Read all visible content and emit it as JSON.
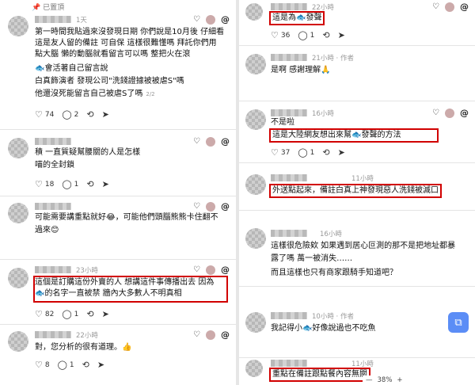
{
  "left": {
    "top_label": "已置頂",
    "posts": [
      {
        "time": "1天",
        "lines": [
          "第一時間我貼過來沒發現日期 你們說是10月後 仔細看",
          "這是友人留的備註 可自保 這樣很難懂嗎 拜託你們用",
          "點大腦 懶的動腦就看留言可以嗎 整把火在滾",
          "🐟會活著自己留言說",
          "白真飾演者 發現公司\"洗錢證據被被虐S\"嗎",
          "他還沒死能留言自己被虐S了嗎"
        ],
        "page_note": "2/2",
        "likes": "74",
        "comments": "2"
      },
      {
        "time": "",
        "lines": [
          "積 一直質疑幫腰關的人是怎樣",
          "喵的全封鎖"
        ],
        "likes": "18",
        "comments": "1"
      },
      {
        "time": "",
        "lines": [
          "可能需要講重點就好😂，可能他們頭腦熊熊卡住翻不",
          "過來😊"
        ],
        "likes": "10",
        "comments": "2"
      },
      {
        "time": "23小時",
        "lines": [
          "這個是訂購這份外賣的人 想講這件事傳播出去 因為",
          "🐟的名字一直被禁 牆內大多數人不明真相"
        ],
        "likes": "82",
        "comments": "1"
      },
      {
        "time": "22小時",
        "lines": [
          "對，您分析的很有道理。👍"
        ],
        "likes": "8",
        "comments": "1"
      }
    ]
  },
  "right": {
    "posts": [
      {
        "time": "22小時",
        "lines": [
          "這是為🐟發聲"
        ],
        "likes": "36",
        "comments": "1"
      },
      {
        "time": "21小時",
        "author_tag": "作者",
        "lines": [
          "是啊 感謝理解🙏"
        ],
        "likes": "",
        "comments": ""
      },
      {
        "time": "16小時",
        "lines": [
          "不是啦",
          "這是大陸網友想出來幫🐟發聲的方法"
        ],
        "likes": "37",
        "comments": "1"
      },
      {
        "time": "11小時",
        "lines": [
          "外送點起來，備註白真上神發現惡人洗錢被滅口"
        ],
        "likes": "",
        "comments": ""
      },
      {
        "time": "16小時",
        "lines": [
          "這樣很危險欸 如果遇到居心叵測的那不是把地址都暴",
          "露了嗎 萬一被消失……",
          "而且這樣也只有商家跟騎手知道吧？"
        ],
        "likes": "",
        "comments": ""
      },
      {
        "time": "10小時",
        "author_tag": "作者",
        "lines": [
          "我記得小🐟好像說過也不吃魚"
        ],
        "likes": "",
        "comments": ""
      },
      {
        "time": "11小時",
        "lines": [
          "重點在備註跟點餐內容無關"
        ],
        "likes": "",
        "comments": ""
      }
    ]
  },
  "zoom": "38%",
  "zoom_minus": "—",
  "zoom_plus": "+",
  "icons": {
    "heart": "♡",
    "comment": "◯",
    "repost": "⟲",
    "share": "➤",
    "threads": "@",
    "float": "⧉"
  }
}
